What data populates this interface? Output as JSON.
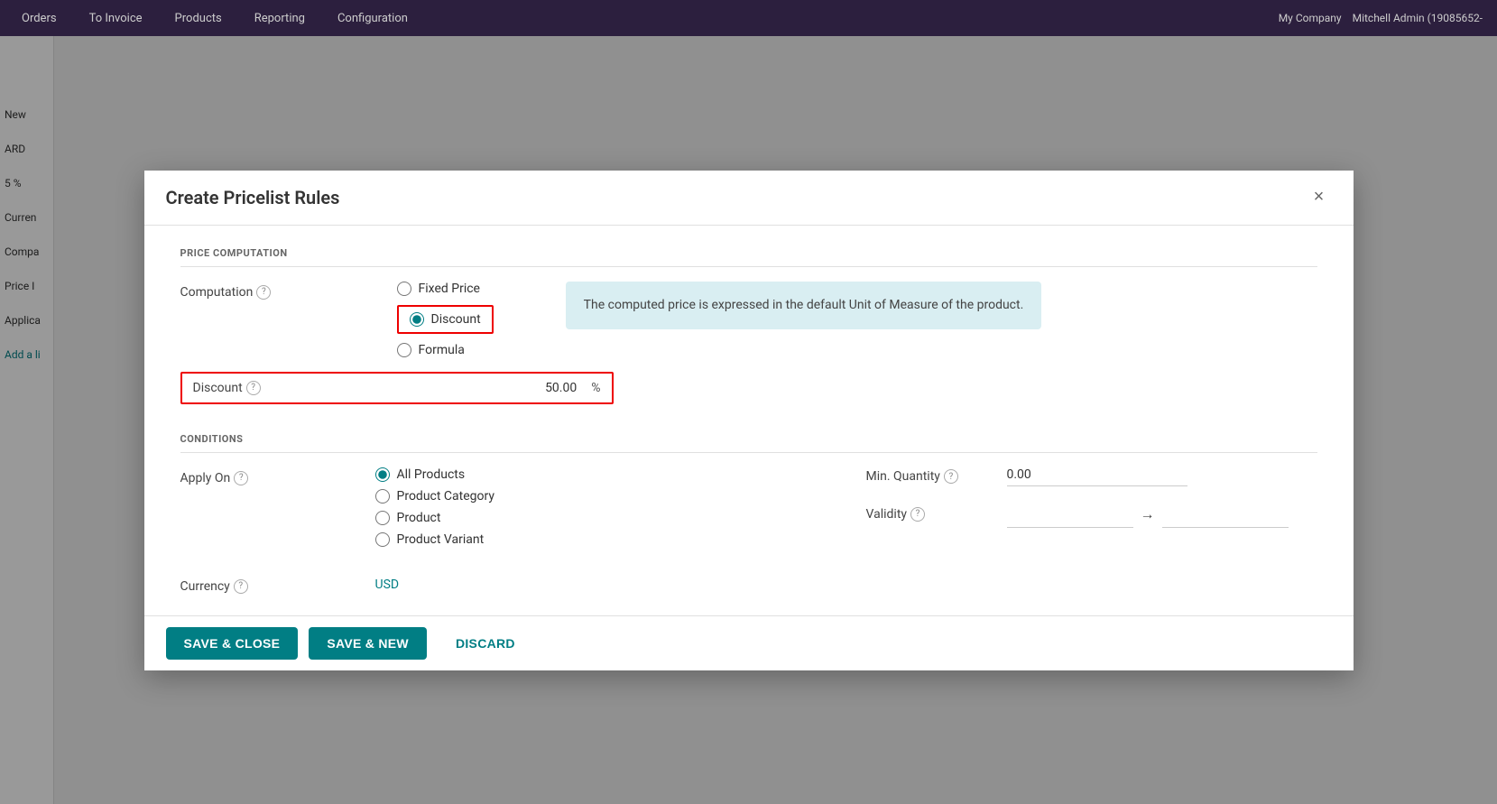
{
  "topnav": {
    "items": [
      "Orders",
      "To Invoice",
      "Products",
      "Reporting",
      "Configuration"
    ],
    "right": [
      "My Company",
      "Mitchell Admin (19085652-"
    ]
  },
  "sidebar": {
    "items": [
      "New",
      "ARD",
      "5 %",
      "Currency",
      "Company",
      "Price I",
      "Applica",
      "Add a li"
    ]
  },
  "modal": {
    "title": "Create Pricelist Rules",
    "close_label": "×",
    "sections": {
      "price_computation": {
        "title": "PRICE COMPUTATION",
        "computation_label": "Computation",
        "computation_help": "?",
        "options": [
          {
            "value": "fixed",
            "label": "Fixed Price",
            "selected": false
          },
          {
            "value": "discount",
            "label": "Discount",
            "selected": true
          },
          {
            "value": "formula",
            "label": "Formula",
            "selected": false
          }
        ],
        "info_text": "The computed price is expressed in the default Unit of Measure of the product.",
        "discount_label": "Discount",
        "discount_help": "?",
        "discount_value": "50.00",
        "discount_unit": "%"
      },
      "conditions": {
        "title": "CONDITIONS",
        "apply_on_label": "Apply On",
        "apply_on_help": "?",
        "apply_on_options": [
          {
            "value": "all",
            "label": "All Products",
            "selected": true
          },
          {
            "value": "category",
            "label": "Product Category",
            "selected": false
          },
          {
            "value": "product",
            "label": "Product",
            "selected": false
          },
          {
            "value": "variant",
            "label": "Product Variant",
            "selected": false
          }
        ],
        "min_quantity_label": "Min. Quantity",
        "min_quantity_help": "?",
        "min_quantity_value": "0.00",
        "validity_label": "Validity",
        "validity_help": "?",
        "validity_arrow": "→",
        "currency_label": "Currency",
        "currency_help": "?",
        "currency_value": "USD"
      }
    },
    "footer": {
      "save_close": "SAVE & CLOSE",
      "save_new": "SAVE & NEW",
      "discard": "DISCARD"
    }
  }
}
